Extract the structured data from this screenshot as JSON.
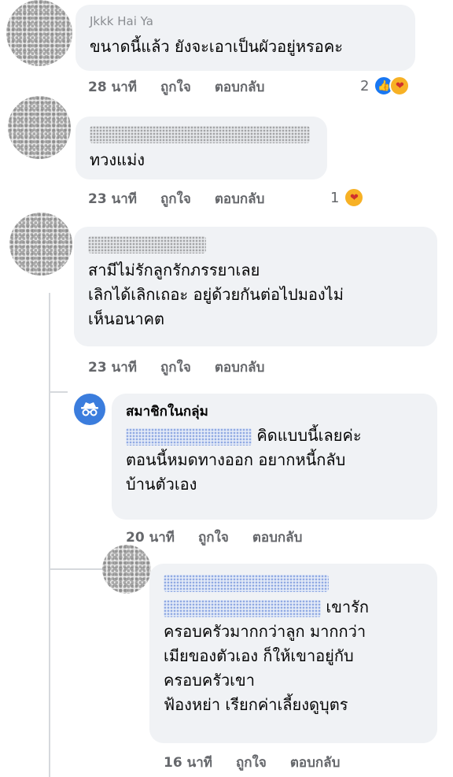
{
  "comments": [
    {
      "author": "Jkkk Hai Ya",
      "text": "ขนาดนี้แล้ว ยังจะเอาเป็นผัวอยู่หรอคะ",
      "time": "28 นาที",
      "like": "ถูกใจ",
      "reply": "ตอบกลับ",
      "reaction_count": "2",
      "reaction_icons": [
        "like-icon",
        "care-icon"
      ]
    },
    {
      "text": "ทวงแม่ง",
      "time": "23 นาที",
      "like": "ถูกใจ",
      "reply": "ตอบกลับ",
      "reaction_count": "1",
      "reaction_icons": [
        "care-icon"
      ]
    },
    {
      "text": "สามีไม่รักลูกรักภรรยาเลย\nเลิกได้เลิกเถอะ อยู่ด้วยกันต่อไปมองไม่\nเห็นอนาคต",
      "time": "23 นาที",
      "like": "ถูกใจ",
      "reply": "ตอบกลับ"
    }
  ],
  "replies": [
    {
      "author": "สมาชิกในกลุ่ม",
      "text_first": "คิดแบบนี้เลยค่ะ",
      "text_rest": "ตอนนี้หมดทางออก อยากหนี้กลับ\nบ้านตัวเอง",
      "time": "20 นาที",
      "like": "ถูกใจ",
      "reply": "ตอบกลับ",
      "avatar_icon": "anonymous-member-icon"
    },
    {
      "text_first": "เขารัก",
      "text_rest": "ครอบครัวมากกว่าลูก มากกว่า\nเมียของตัวเอง ก็ให้เขาอยู่กับ\nครอบครัวเขา\nฟ้องหย่า เรียกค่าเลี้ยงดูบุตร",
      "time": "16 นาที",
      "like": "ถูกใจ",
      "reply": "ตอบกลับ"
    }
  ],
  "colors": {
    "bubble": "#f0f2f5",
    "meta": "#65676b",
    "like_blue": "#1877f2",
    "thread_line": "#d6d9dd"
  }
}
